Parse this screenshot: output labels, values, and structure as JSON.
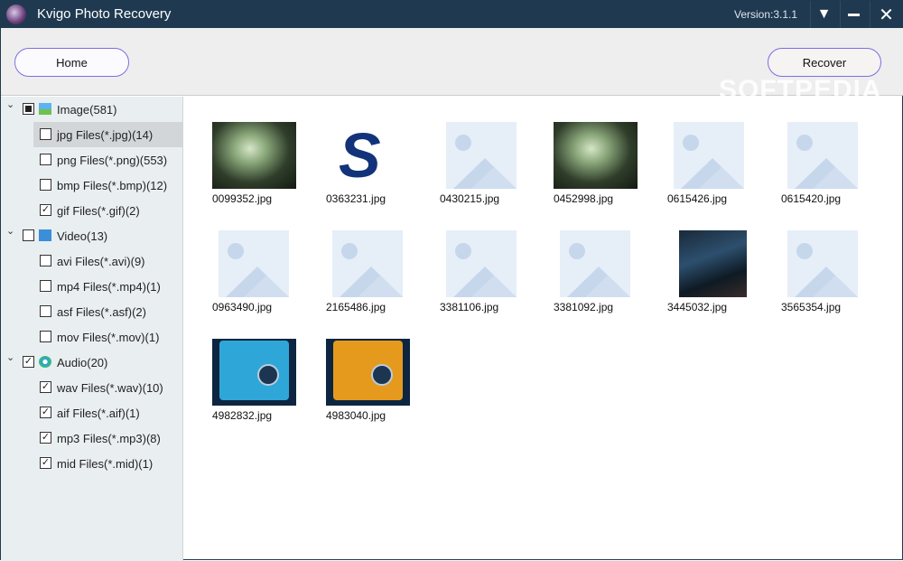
{
  "window": {
    "title": "Kvigo Photo Recovery",
    "version": "Version:3.1.1"
  },
  "toolbar": {
    "home": "Home",
    "recover": "Recover",
    "watermark": "SOFTPEDIA"
  },
  "tree": [
    {
      "label": "Image(581)",
      "level": 0,
      "state": "partial",
      "icon": "image-icon",
      "expanded": true
    },
    {
      "label": "jpg Files(*.jpg)(14)",
      "level": 1,
      "state": "unchecked",
      "selected": true
    },
    {
      "label": "png Files(*.png)(553)",
      "level": 1,
      "state": "unchecked"
    },
    {
      "label": "bmp Files(*.bmp)(12)",
      "level": 1,
      "state": "unchecked"
    },
    {
      "label": "gif Files(*.gif)(2)",
      "level": 1,
      "state": "checked"
    },
    {
      "label": "Video(13)",
      "level": 0,
      "state": "unchecked",
      "icon": "video-icon",
      "expanded": true
    },
    {
      "label": "avi Files(*.avi)(9)",
      "level": 1,
      "state": "unchecked"
    },
    {
      "label": "mp4 Files(*.mp4)(1)",
      "level": 1,
      "state": "unchecked"
    },
    {
      "label": "asf Files(*.asf)(2)",
      "level": 1,
      "state": "unchecked"
    },
    {
      "label": "mov Files(*.mov)(1)",
      "level": 1,
      "state": "unchecked"
    },
    {
      "label": "Audio(20)",
      "level": 0,
      "state": "checked",
      "icon": "audio-icon",
      "expanded": true
    },
    {
      "label": "wav Files(*.wav)(10)",
      "level": 1,
      "state": "checked"
    },
    {
      "label": "aif Files(*.aif)(1)",
      "level": 1,
      "state": "checked"
    },
    {
      "label": "mp3 Files(*.mp3)(8)",
      "level": 1,
      "state": "checked"
    },
    {
      "label": "mid Files(*.mid)(1)",
      "level": 1,
      "state": "checked"
    }
  ],
  "files": [
    {
      "name": "0099352.jpg",
      "thumb": "forest"
    },
    {
      "name": "0363231.jpg",
      "thumb": "logo-s"
    },
    {
      "name": "0430215.jpg",
      "thumb": "placeholder"
    },
    {
      "name": "0452998.jpg",
      "thumb": "forest"
    },
    {
      "name": "0615426.jpg",
      "thumb": "placeholder"
    },
    {
      "name": "0615420.jpg",
      "thumb": "placeholder"
    },
    {
      "name": "0963490.jpg",
      "thumb": "placeholder"
    },
    {
      "name": "2165486.jpg",
      "thumb": "placeholder"
    },
    {
      "name": "3381106.jpg",
      "thumb": "placeholder"
    },
    {
      "name": "3381092.jpg",
      "thumb": "placeholder"
    },
    {
      "name": "3445032.jpg",
      "thumb": "screen"
    },
    {
      "name": "3565354.jpg",
      "thumb": "placeholder"
    },
    {
      "name": "4982832.jpg",
      "thumb": "blue-box"
    },
    {
      "name": "4983040.jpg",
      "thumb": "orange-box"
    }
  ]
}
